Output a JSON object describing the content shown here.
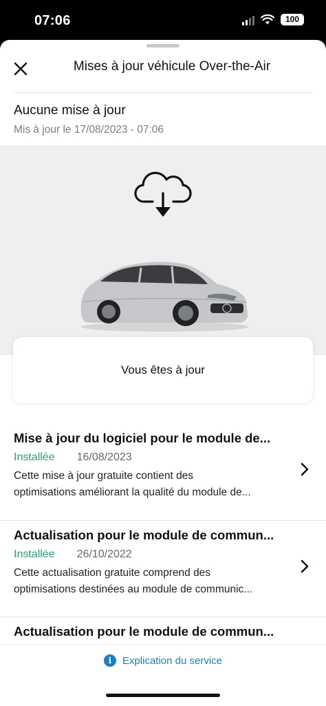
{
  "status_bar": {
    "time": "07:06",
    "battery": "100"
  },
  "header": {
    "title": "Mises à jour véhicule Over-the-Air"
  },
  "summary": {
    "title": "Aucune mise à jour",
    "subtitle": "Mis à jour le 17/08/2023 - 07:06"
  },
  "status_card": {
    "text": "Vous êtes à jour"
  },
  "updates": [
    {
      "title": "Mise à jour du logiciel pour le module de...",
      "status": "Installée",
      "date": "16/08/2023",
      "desc_line1": "Cette mise à jour gratuite contient des",
      "desc_line2": "optimisations améliorant la qualité du module de..."
    },
    {
      "title": "Actualisation pour le module de commun...",
      "status": "Installée",
      "date": "26/10/2022",
      "desc_line1": "Cette actualisation gratuite comprend des",
      "desc_line2": "optimisations destinées au module de communic..."
    },
    {
      "title": "Actualisation pour le module de commun..."
    }
  ],
  "footer": {
    "link_label": "Explication du service"
  },
  "colors": {
    "accent": "#1e7fbf",
    "installed": "#2aa36a",
    "hero_bg": "#efefef"
  }
}
